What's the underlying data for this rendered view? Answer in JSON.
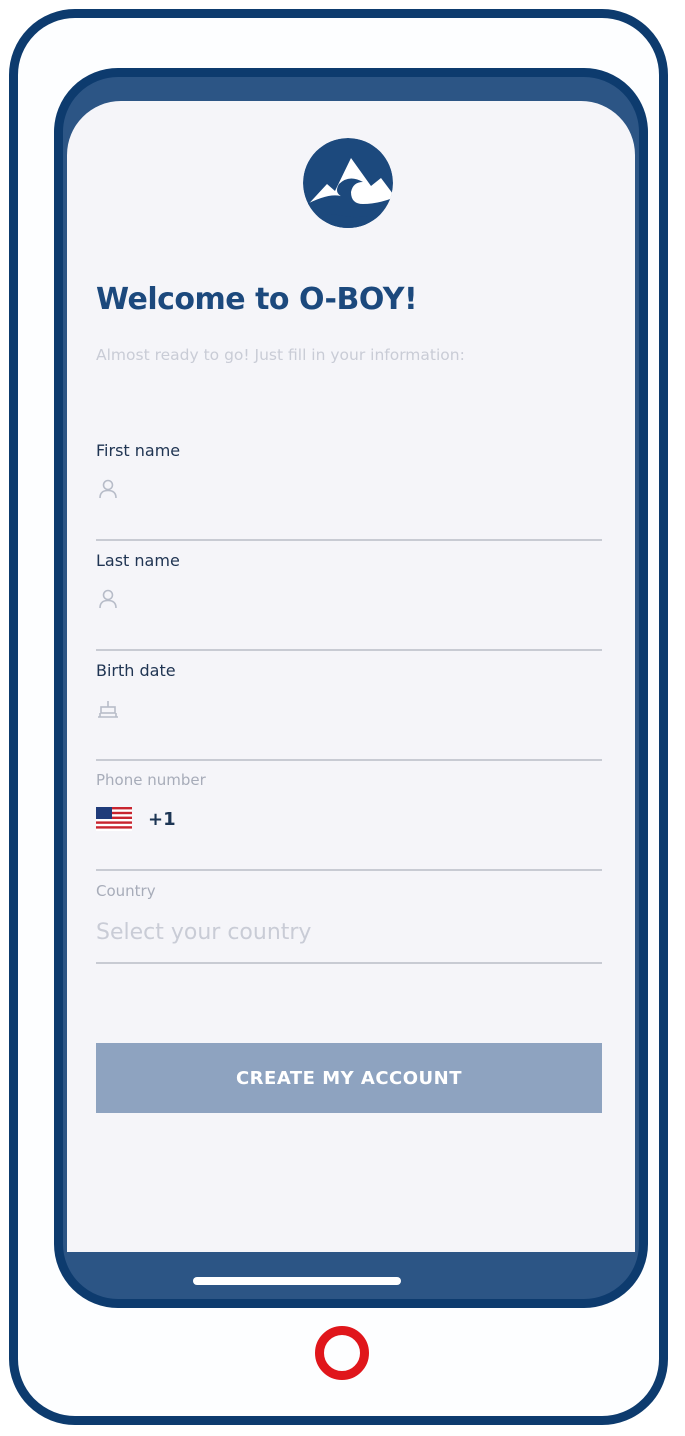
{
  "app": {
    "title": "Welcome to O-BOY!",
    "subtitle": "Almost ready to go! Just fill in your information:"
  },
  "logo": {
    "icon": "mountain-wave-logo"
  },
  "form": {
    "first_name": {
      "label": "First name",
      "value": "",
      "icon": "person-icon"
    },
    "last_name": {
      "label": "Last name",
      "value": "",
      "icon": "person-icon"
    },
    "birth_date": {
      "label": "Birth date",
      "value": "",
      "icon": "cake-icon"
    },
    "phone": {
      "label": "Phone number",
      "country_flag": "us-flag-icon",
      "dial_code": "+1",
      "value": ""
    },
    "country": {
      "label": "Country",
      "placeholder": "Select your country"
    }
  },
  "cta": {
    "label": "CREATE MY ACCOUNT"
  },
  "colors": {
    "brand": "#1c497d",
    "device_frame": "#0d3b6e",
    "button_disabled": "#8ea3c0",
    "home_button": "#e0161b"
  }
}
